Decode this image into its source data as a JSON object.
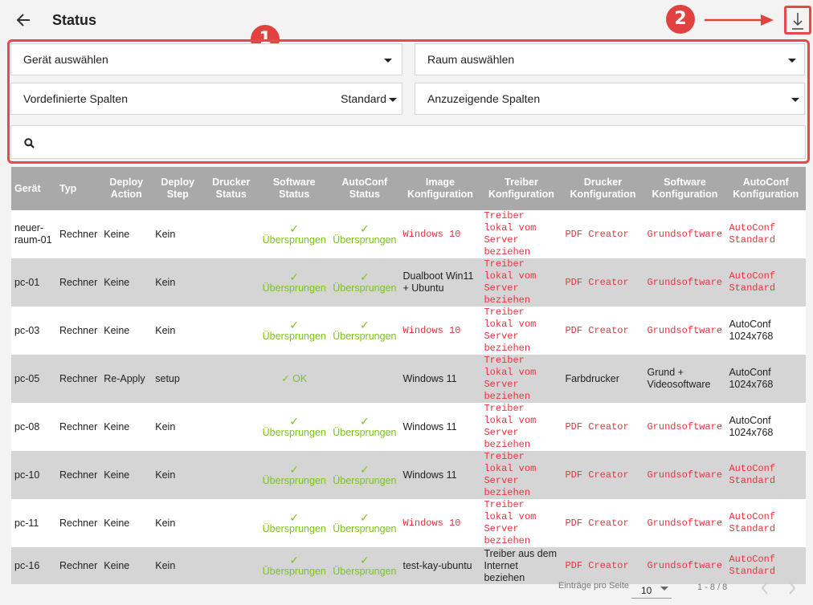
{
  "header": {
    "title": "Status",
    "back_icon": "arrow-left-icon",
    "download_icon": "download-icon"
  },
  "annotations": {
    "badge1": "1",
    "badge2": "2",
    "accent": "#e8484a"
  },
  "filters": {
    "device": "Gerät auswählen",
    "room": "Raum auswählen",
    "predefined_columns": "Vordefinierte Spalten",
    "predefined_value": "Standard",
    "display_columns": "Anzuzeigende Spalten",
    "search_placeholder": ""
  },
  "table": {
    "headers": [
      "Gerät",
      "Typ",
      "Deploy Action",
      "Deploy Step",
      "Drucker Status",
      "Software Status",
      "AutoConf Status",
      "Image Konfiguration",
      "Treiber Konfiguration",
      "Drucker Konfiguration",
      "Software Konfiguration",
      "AutoConf Konfiguration"
    ],
    "rows": [
      {
        "device": "neuer-raum-01",
        "type": "Rechner",
        "action": "Keine",
        "step": "Kein",
        "printer_status": "",
        "sw_status": "✓ Übersprungen",
        "ac_status": "✓ Übersprungen",
        "image": "Windows 10",
        "driver": "Treiber lokal vom Server beziehen",
        "printer": "PDF Creator",
        "software": "Grundsoftware",
        "autoconf": "AutoConf Standard"
      },
      {
        "device": "pc-01",
        "type": "Rechner",
        "action": "Keine",
        "step": "Kein",
        "printer_status": "",
        "sw_status": "✓ Übersprungen",
        "ac_status": "✓ Übersprungen",
        "image": "Dualboot Win11 + Ubuntu",
        "driver": "Treiber lokal vom Server beziehen",
        "printer": "PDF Creator",
        "software": "Grundsoftware",
        "autoconf": "AutoConf Standard"
      },
      {
        "device": "pc-03",
        "type": "Rechner",
        "action": "Keine",
        "step": "Kein",
        "printer_status": "",
        "sw_status": "✓ Übersprungen",
        "ac_status": "✓ Übersprungen",
        "image": "Windows 10",
        "driver": "Treiber lokal vom Server beziehen",
        "printer": "PDF Creator",
        "software": "Grundsoftware",
        "autoconf": "AutoConf 1024x768"
      },
      {
        "device": "pc-05",
        "type": "Rechner",
        "action": "Re-Apply",
        "step": "setup",
        "printer_status": "",
        "sw_status": "✓ OK",
        "ac_status": "",
        "image": "Windows 11",
        "driver": "Treiber lokal vom Server beziehen",
        "printer": "Farbdrucker",
        "software": "Grund + Videosoftware",
        "autoconf": "AutoConf 1024x768"
      },
      {
        "device": "pc-08",
        "type": "Rechner",
        "action": "Keine",
        "step": "Kein",
        "printer_status": "",
        "sw_status": "✓ Übersprungen",
        "ac_status": "✓ Übersprungen",
        "image": "Windows 11",
        "driver": "Treiber lokal vom Server beziehen",
        "printer": "PDF Creator",
        "software": "Grundsoftware",
        "autoconf": "AutoConf 1024x768"
      },
      {
        "device": "pc-10",
        "type": "Rechner",
        "action": "Keine",
        "step": "Kein",
        "printer_status": "",
        "sw_status": "✓ Übersprungen",
        "ac_status": "✓ Übersprungen",
        "image": "Windows 11",
        "driver": "Treiber lokal vom Server beziehen",
        "printer": "PDF Creator",
        "software": "Grundsoftware",
        "autoconf": "AutoConf Standard"
      },
      {
        "device": "pc-11",
        "type": "Rechner",
        "action": "Keine",
        "step": "Kein",
        "printer_status": "",
        "sw_status": "✓ Übersprungen",
        "ac_status": "✓ Übersprungen",
        "image": "Windows 10",
        "driver": "Treiber lokal vom Server beziehen",
        "printer": "PDF Creator",
        "software": "Grundsoftware",
        "autoconf": "AutoConf Standard"
      },
      {
        "device": "pc-16",
        "type": "Rechner",
        "action": "Keine",
        "step": "Kein",
        "printer_status": "",
        "sw_status": "✓ Übersprungen",
        "ac_status": "✓ Übersprungen",
        "image": "test-kay-ubuntu",
        "driver": "Treiber aus dem Internet beziehen",
        "printer": "PDF Creator",
        "software": "Grundsoftware",
        "autoconf": "AutoConf Standard"
      }
    ]
  },
  "pagination": {
    "per_page_label": "Einträge pro Seite",
    "per_page": "10",
    "range": "1 - 8 / 8",
    "prev_icon": "chevron-left-icon",
    "next_icon": "chevron-right-icon"
  },
  "colors": {
    "link_red": "#e8333f",
    "ok_green": "#7dc21e",
    "header_gray": "#a9a9a9"
  }
}
